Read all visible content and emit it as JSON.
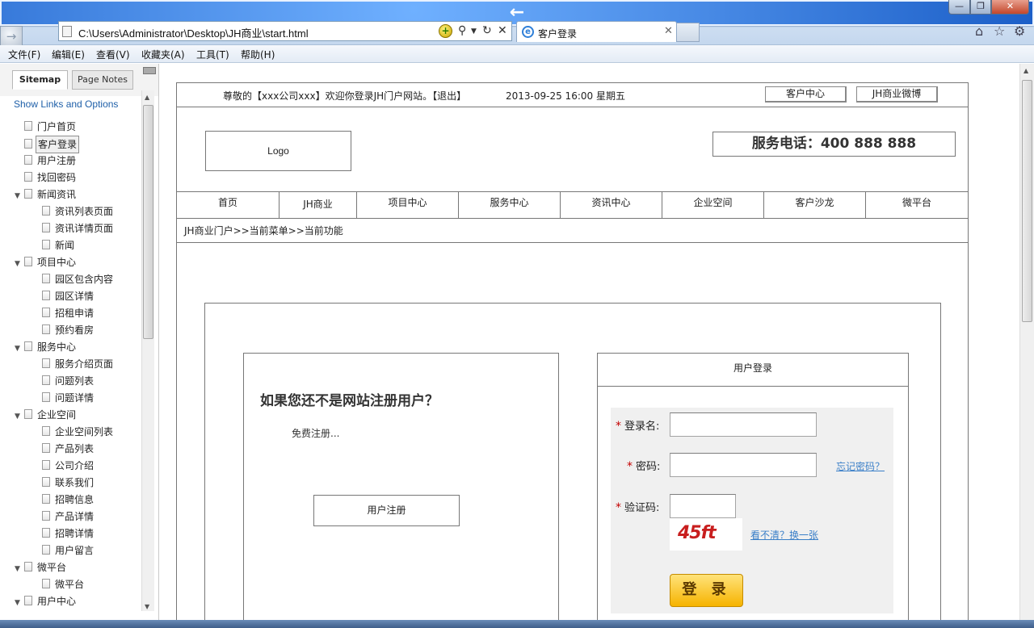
{
  "browser": {
    "address": "C:\\Users\\Administrator\\Desktop\\JH商业\\start.html",
    "tab_title": "客户登录",
    "menu": [
      "文件(F)",
      "编辑(E)",
      "查看(V)",
      "收藏夹(A)",
      "工具(T)",
      "帮助(H)"
    ]
  },
  "sitemap": {
    "tabs": [
      "Sitemap",
      "Page Notes"
    ],
    "show_links": "Show Links and Options",
    "tree": [
      {
        "label": "门户首页",
        "level": 0,
        "toggle": ""
      },
      {
        "label": "客户登录",
        "level": 0,
        "toggle": "",
        "selected": true
      },
      {
        "label": "用户注册",
        "level": 0,
        "toggle": ""
      },
      {
        "label": "找回密码",
        "level": 0,
        "toggle": ""
      },
      {
        "label": "新闻资讯",
        "level": 0,
        "toggle": "▼"
      },
      {
        "label": "资讯列表页面",
        "level": 1,
        "toggle": ""
      },
      {
        "label": "资讯详情页面",
        "level": 1,
        "toggle": ""
      },
      {
        "label": "新闻",
        "level": 1,
        "toggle": ""
      },
      {
        "label": "项目中心",
        "level": 0,
        "toggle": "▼"
      },
      {
        "label": "园区包含内容",
        "level": 1,
        "toggle": ""
      },
      {
        "label": "园区详情",
        "level": 1,
        "toggle": ""
      },
      {
        "label": "招租申请",
        "level": 1,
        "toggle": ""
      },
      {
        "label": "预约看房",
        "level": 1,
        "toggle": ""
      },
      {
        "label": "服务中心",
        "level": 0,
        "toggle": "▼"
      },
      {
        "label": "服务介绍页面",
        "level": 1,
        "toggle": ""
      },
      {
        "label": "问题列表",
        "level": 1,
        "toggle": ""
      },
      {
        "label": "问题详情",
        "level": 1,
        "toggle": ""
      },
      {
        "label": "企业空间",
        "level": 0,
        "toggle": "▼"
      },
      {
        "label": "企业空间列表",
        "level": 1,
        "toggle": ""
      },
      {
        "label": "产品列表",
        "level": 1,
        "toggle": ""
      },
      {
        "label": "公司介绍",
        "level": 1,
        "toggle": ""
      },
      {
        "label": "联系我们",
        "level": 1,
        "toggle": ""
      },
      {
        "label": "招聘信息",
        "level": 1,
        "toggle": ""
      },
      {
        "label": "产品详情",
        "level": 1,
        "toggle": ""
      },
      {
        "label": "招聘详情",
        "level": 1,
        "toggle": ""
      },
      {
        "label": "用户留言",
        "level": 1,
        "toggle": ""
      },
      {
        "label": "微平台",
        "level": 0,
        "toggle": "▼"
      },
      {
        "label": "微平台",
        "level": 1,
        "toggle": ""
      },
      {
        "label": "用户中心",
        "level": 0,
        "toggle": "▼"
      }
    ]
  },
  "page": {
    "welcome": "尊敬的【xxx公司xxx】欢迎你登录JH门户网站。【退出】",
    "datetime": "2013-09-25 16:00    星期五",
    "top_buttons": [
      "客户中心",
      "JH商业微博"
    ],
    "logo": "Logo",
    "phone": "服务电话：400 888 888",
    "nav": [
      "首页",
      "JH商业",
      "项目中心",
      "服务中心",
      "资讯中心",
      "企业空间",
      "客户沙龙",
      "微平台"
    ],
    "breadcrumb": "JH商业门户>>当前菜单>>当前功能",
    "register": {
      "title": "如果您还不是网站注册用户？",
      "free": "免费注册...",
      "button": "用户注册"
    },
    "login": {
      "title": "用户登录",
      "username_label": "登录名:",
      "password_label": "密码:",
      "forgot": "忘记密码？",
      "captcha_label": "验证码:",
      "captcha_text": "45ft",
      "refresh_captcha": "看不清？换一张",
      "submit": "登 录",
      "required_mark": "*"
    }
  }
}
